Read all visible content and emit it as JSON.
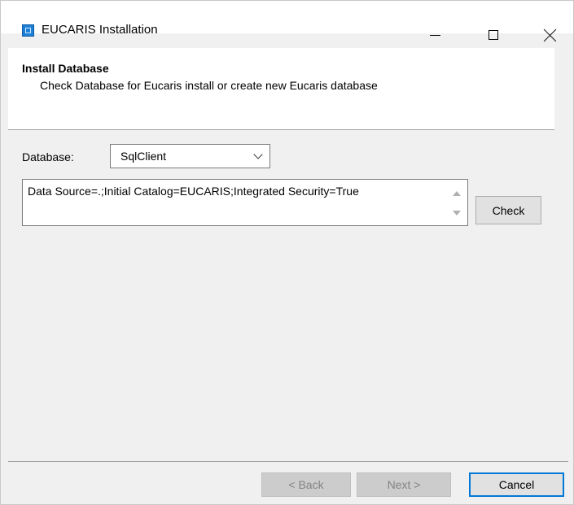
{
  "window": {
    "title": "EUCARIS Installation",
    "icon": "installer-app-icon",
    "controls": [
      "minimize-icon",
      "maximize-icon",
      "close-icon"
    ]
  },
  "header": {
    "title": "Install Database",
    "subtitle": "Check Database for Eucaris install or create new Eucaris database"
  },
  "form": {
    "database_label": "Database:",
    "provider_selected": "SqlClient",
    "connection_string": "Data Source=.;Initial Catalog=EUCARIS;Integrated Security=True",
    "check_label": "Check"
  },
  "footer": {
    "back_label": "< Back",
    "next_label": "Next >",
    "cancel_label": "Cancel"
  },
  "colors": {
    "window_bg": "#f0f0f0",
    "accent": "#0078d7",
    "disabled_text": "#838383"
  }
}
